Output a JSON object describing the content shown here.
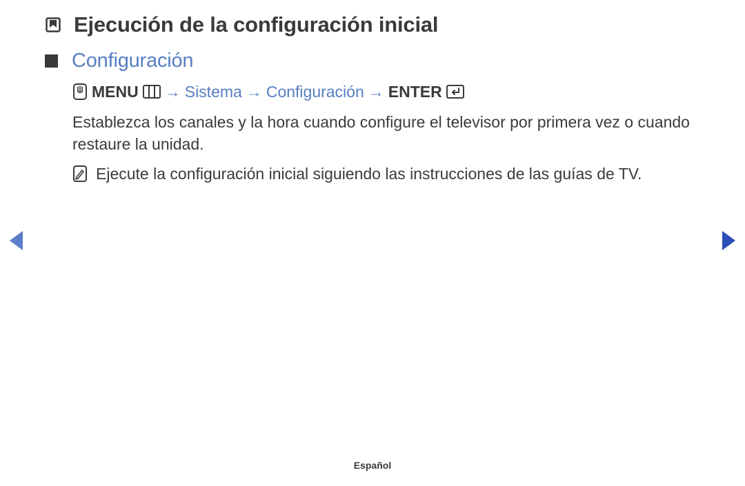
{
  "page": {
    "title": "Ejecución de la configuración inicial"
  },
  "section": {
    "title": "Configuración"
  },
  "nav": {
    "menu_label": "MENU",
    "path1": "Sistema",
    "path2": "Configuración",
    "enter_label": "ENTER",
    "arrow": "→"
  },
  "body": {
    "paragraph": "Establezca los canales y la hora cuando configure el televisor por primera vez o cuando restaure la unidad."
  },
  "note": {
    "text": "Ejecute la configuración inicial siguiendo las instrucciones de las guías de TV."
  },
  "footer": {
    "language": "Español"
  },
  "icons": {
    "bookmark": "bookmark-icon",
    "bullet": "section-bullet",
    "remote": "remote-icon",
    "menu_glyph": "menu-glyph",
    "enter_glyph": "enter-glyph",
    "note": "note-icon",
    "prev": "prev-arrow-icon",
    "next": "next-arrow-icon"
  }
}
